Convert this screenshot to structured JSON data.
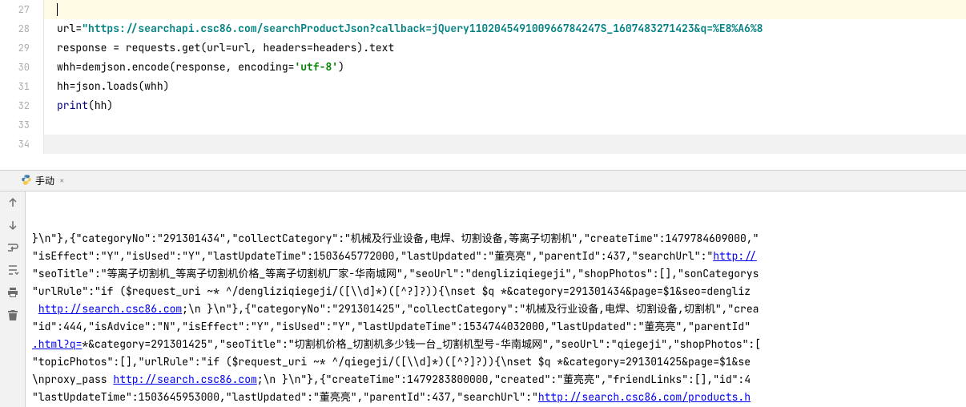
{
  "editor": {
    "lines": [
      {
        "num": "27",
        "highlight": true,
        "segments": []
      },
      {
        "num": "28",
        "highlight": false,
        "segments": [
          {
            "t": "url",
            "c": "tok-var"
          },
          {
            "t": "=",
            "c": "tok-op"
          },
          {
            "t": "\"https://searchapi.csc86.com/searchProductJson?callback=jQuery110204549100966784247S_1607483271423&q=%E8%A6%8",
            "c": "tok-str"
          }
        ]
      },
      {
        "num": "29",
        "highlight": false,
        "segments": [
          {
            "t": "response ",
            "c": "tok-var"
          },
          {
            "t": "= ",
            "c": "tok-op"
          },
          {
            "t": "requests.get(",
            "c": "tok-var"
          },
          {
            "t": "url",
            "c": "tok-var"
          },
          {
            "t": "=url, ",
            "c": "tok-var"
          },
          {
            "t": "headers",
            "c": "tok-var"
          },
          {
            "t": "=headers).text",
            "c": "tok-var"
          }
        ]
      },
      {
        "num": "30",
        "highlight": false,
        "segments": [
          {
            "t": "whh",
            "c": "tok-var"
          },
          {
            "t": "=",
            "c": "tok-op"
          },
          {
            "t": "demjson.encode(response, ",
            "c": "tok-var"
          },
          {
            "t": "encoding",
            "c": "tok-var"
          },
          {
            "t": "=",
            "c": "tok-op"
          },
          {
            "t": "'utf-8'",
            "c": "tok-str-normal"
          },
          {
            "t": ")",
            "c": "tok-var"
          }
        ]
      },
      {
        "num": "31",
        "highlight": false,
        "segments": [
          {
            "t": "hh",
            "c": "tok-var"
          },
          {
            "t": "=",
            "c": "tok-op"
          },
          {
            "t": "json.loads(whh)",
            "c": "tok-var"
          }
        ]
      },
      {
        "num": "32",
        "highlight": false,
        "segments": [
          {
            "t": "print",
            "c": "tok-builtin"
          },
          {
            "t": "(hh)",
            "c": "tok-var"
          }
        ]
      },
      {
        "num": "33",
        "highlight": false,
        "segments": []
      },
      {
        "num": "34",
        "highlight": false,
        "gray": true,
        "segments": []
      }
    ]
  },
  "tab": {
    "label": "手动",
    "close": "×"
  },
  "console": {
    "lines": [
      "}\\n\"},{\"categoryNo\":\"291301434\",\"collectCategory\":\"机械及行业设备,电焊、切割设备,等离子切割机\",\"createTime\":1479784609000,\"",
      "\"isEffect\":\"Y\",\"isUsed\":\"Y\",\"lastUpdateTime\":1503645772000,\"lastUpdated\":\"董亮亮\",\"parentId\":437,\"searchUrl\":\"http://",
      "\"seoTitle\":\"等离子切割机_等离子切割机价格_等离子切割机厂家-华南城网\",\"seoUrl\":\"dengliziqiegeji\",\"shopPhotos\":[],\"sonCategorys",
      "\"urlRule\":\"if ($request_uri ~* ^/dengliziqiegeji/([\\\\d]*)([^?]?)){\\nset $q *&category=291301434&page=$1&seo=dengliz",
      " http://search.csc86.com;\\n }\\n\"},{\"categoryNo\":\"291301425\",\"collectCategory\":\"机械及行业设备,电焊、切割设备,切割机\",\"crea",
      "\"id\":444,\"isAdvice\":\"N\",\"isEffect\":\"Y\",\"isUsed\":\"Y\",\"lastUpdateTime\":1534744032000,\"lastUpdated\":\"董亮亮\",\"parentId\"",
      ".html?q=*&category=291301425\",\"seoTitle\":\"切割机价格_切割机多少钱一台_切割机型号-华南城网\",\"seoUrl\":\"qiegeji\",\"shopPhotos\":[",
      "\"topicPhotos\":[],\"urlRule\":\"if ($request_uri ~* ^/qiegeji/([\\\\d]*)([^?]?)){\\nset $q *&category=291301425&page=$1&se",
      "\\nproxy_pass http://search.csc86.com;\\n }\\n\"},{\"createTime\":1479283800000,\"created\":\"董亮亮\",\"friendLinks\":[],\"id\":4",
      "\"lastUpdateTime\":1503645953000,\"lastUpdated\":\"董亮亮\",\"parentId\":437,\"searchUrl\":\"http://search.csc86.com/products.h"
    ],
    "link_parts": {
      "1": {
        "prefix": "\"isEffect\":\"Y\",\"isUsed\":\"Y\",\"lastUpdateTime\":1503645772000,\"lastUpdated\":\"董亮亮\",\"parentId\":437,\"searchUrl\":\"",
        "link": "http://"
      },
      "4": {
        "prefix": " ",
        "link": "http://search.csc86.com",
        "suffix": ";\\n }\\n\"},{\"categoryNo\":\"291301425\",\"collectCategory\":\"机械及行业设备,电焊、切割设备,切割机\",\"crea"
      },
      "6": {
        "link": ".html?q=",
        "suffix": "*&category=291301425\",\"seoTitle\":\"切割机价格_切割机多少钱一台_切割机型号-华南城网\",\"seoUrl\":\"qiegeji\",\"shopPhotos\":["
      },
      "8": {
        "prefix": "\\nproxy_pass ",
        "link": "http://search.csc86.com",
        "suffix": ";\\n }\\n\"},{\"createTime\":1479283800000,\"created\":\"董亮亮\",\"friendLinks\":[],\"id\":4"
      },
      "9": {
        "prefix": "\"lastUpdateTime\":1503645953000,\"lastUpdated\":\"董亮亮\",\"parentId\":437,\"searchUrl\":\"",
        "link": "http://search.csc86.com/products.h"
      }
    }
  },
  "toolbar_icons": [
    "arrow-up-icon",
    "arrow-down-icon",
    "soft-wrap-icon",
    "scroll-to-end-icon",
    "print-icon",
    "trash-icon"
  ]
}
